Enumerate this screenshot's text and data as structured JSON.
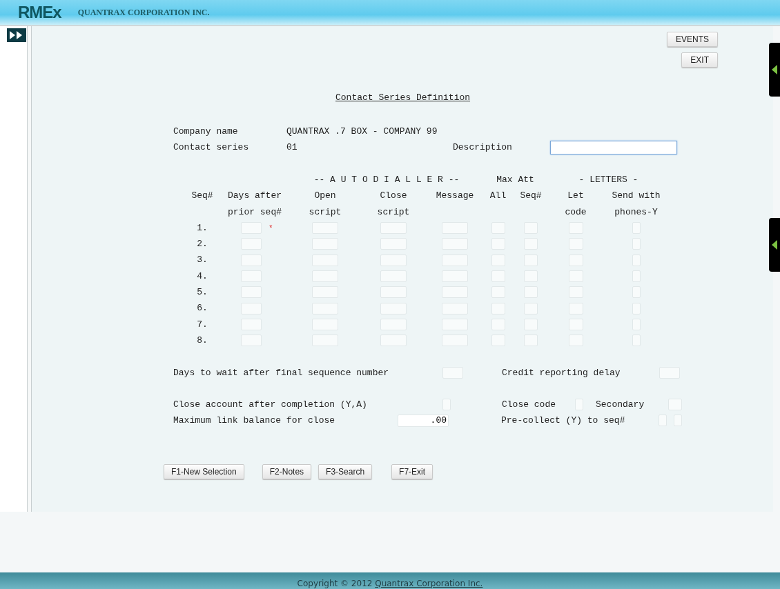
{
  "header": {
    "logo": "RMEx",
    "company": "QUANTRAX CORPORATION INC."
  },
  "top_buttons": [
    "EVENTS",
    "EXIT"
  ],
  "title": "Contact Series Definition",
  "company": {
    "label": "Company name",
    "value": "QUANTRAX .7 BOX - COMPANY 99"
  },
  "contact_series": {
    "label": "Contact series",
    "value": "01"
  },
  "description": {
    "label": "Description",
    "focused": true
  },
  "groups": [
    {
      "label": "-- A U T O D I A L L E R --"
    },
    {
      "label": "Max Att"
    },
    {
      "label": "- LETTERS -"
    }
  ],
  "columns": [
    {
      "lines": [
        "Seq#"
      ]
    },
    {
      "lines": [
        "Days after",
        "prior seq#"
      ]
    },
    {
      "lines": [
        "Open",
        "script"
      ]
    },
    {
      "lines": [
        "Close",
        "script"
      ]
    },
    {
      "lines": [
        "Message"
      ]
    },
    {
      "lines": [
        "All"
      ]
    },
    {
      "lines": [
        "Seq#"
      ]
    },
    {
      "lines": [
        "Let",
        "code"
      ]
    },
    {
      "lines": [
        "Send with",
        "phones-Y"
      ]
    }
  ],
  "rows": [
    {
      "seq": "1.",
      "mark": "*"
    },
    {
      "seq": "2."
    },
    {
      "seq": "3."
    },
    {
      "seq": "4."
    },
    {
      "seq": "5."
    },
    {
      "seq": "6."
    },
    {
      "seq": "7."
    },
    {
      "seq": "8."
    }
  ],
  "days_wait": {
    "label": "Days to wait after final sequence number"
  },
  "credit_delay": {
    "label": "Credit reporting delay"
  },
  "close_account": {
    "label": "Close account after completion (Y,A)"
  },
  "close_code": {
    "label": "Close code"
  },
  "secondary": {
    "label": "Secondary"
  },
  "max_balance": {
    "label": "Maximum link balance for close",
    "value": ".00"
  },
  "pre_collect": {
    "label": "Pre-collect (Y) to seq#"
  },
  "function_keys": [
    "F1-New Selection",
    "F2-Notes",
    "F3-Search",
    "F7-Exit"
  ],
  "footer": {
    "text": "Copyright © 2012",
    "link": "Quantrax Corporation Inc."
  }
}
